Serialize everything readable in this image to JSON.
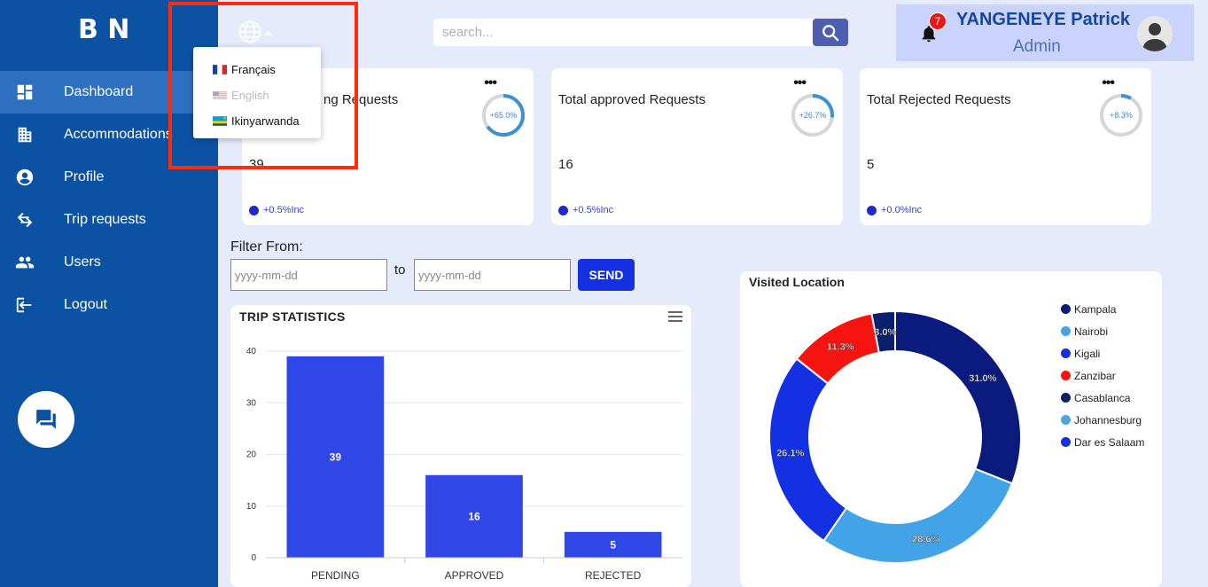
{
  "sidebar": {
    "logo": "B N",
    "items": [
      {
        "label": "Dashboard",
        "icon": "dashboard-icon",
        "active": true
      },
      {
        "label": "Accommodations",
        "icon": "building-icon",
        "active": false
      },
      {
        "label": "Profile",
        "icon": "account-circle-icon",
        "active": false
      },
      {
        "label": "Trip requests",
        "icon": "trip-icon",
        "active": false
      },
      {
        "label": "Users",
        "icon": "users-icon",
        "active": false
      },
      {
        "label": "Logout",
        "icon": "logout-icon",
        "active": false
      }
    ],
    "chat_icon": "chat-icon",
    "color": "#0c52a3"
  },
  "header": {
    "search_placeholder": "search...",
    "notifications": "7",
    "user_name": "YANGENEYE Patrick",
    "user_role": "Admin"
  },
  "language_menu": {
    "items": [
      {
        "label": "Français",
        "flag": "fr",
        "disabled": false
      },
      {
        "label": "English",
        "flag": "us",
        "disabled": true
      },
      {
        "label": "Ikinyarwanda",
        "flag": "rw",
        "disabled": false
      }
    ]
  },
  "cards": [
    {
      "title": "Total Pending Requests",
      "visible_title": "ng Requests",
      "value": "39",
      "ring": 65.0,
      "ring_label": "+65.0%",
      "foot": "+0.5%Inc"
    },
    {
      "title": "Total approved Requests",
      "visible_title": "Total approved Requests",
      "value": "16",
      "ring": 26.7,
      "ring_label": "+26.7%",
      "foot": "+0.5%Inc"
    },
    {
      "title": "Total Rejected Requests",
      "visible_title": "Total Rejected Requests",
      "value": "5",
      "ring": 8.3,
      "ring_label": "+8.3%",
      "foot": "+0.0%Inc"
    }
  ],
  "filter": {
    "label": "Filter From:",
    "from_placeholder": "yyyy-mm-dd",
    "to_label": "to",
    "to_placeholder": "yyyy-mm-dd",
    "send_label": "SEND"
  },
  "chart_data": [
    {
      "type": "bar",
      "title": "TRIP STATISTICS",
      "categories": [
        "PENDING",
        "APPROVED",
        "REJECTED"
      ],
      "values": [
        39,
        16,
        5
      ],
      "ylim": [
        0,
        40
      ],
      "yticks": [
        0,
        10,
        20,
        30,
        40
      ],
      "color": "#3047e8",
      "grid": true
    },
    {
      "type": "pie",
      "title": "Visited Location",
      "labels": [
        "Kampala",
        "Nairobi",
        "Kigali",
        "Zanzibar",
        "Casablanca",
        "Johannesburg",
        "Dar es Salaam"
      ],
      "values": [
        31.0,
        28.6,
        26.1,
        11.3,
        3.0,
        0,
        0
      ],
      "value_labels": [
        "31.0%",
        "28.6%",
        "26.1%",
        "11.3%",
        "3.0%",
        "",
        ""
      ],
      "colors": [
        "#0b1a7d",
        "#42a3e6",
        "#1330e2",
        "#f5140f",
        "#0a1f6e",
        "#4aa6e0",
        "#1330e2"
      ],
      "legend": "right"
    }
  ]
}
